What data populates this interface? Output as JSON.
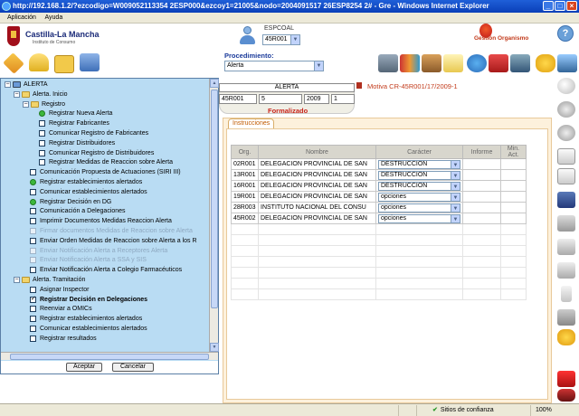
{
  "browser": {
    "title": "http://192.168.1.2/?ezcodigo=W009052113354 2ESP000&ezcoy1=21005&nodo=2004091517 26ESP8254 2# - Gre - Windows Internet Explorer",
    "menu": [
      "Aplicación",
      "Ayuda"
    ]
  },
  "header": {
    "logo_title": "Castilla-La Mancha",
    "logo_subtitle": "Instituto de Consumo",
    "espcoal_label": "ESPCOAL",
    "espcoal_value": "45R001",
    "gestion_label": "Gestión Organismo",
    "help_icon": "?"
  },
  "toolbar": {
    "procedimiento_label": "Procedimiento:",
    "procedimiento_value": "Alerta"
  },
  "record": {
    "title": "ALERTA",
    "fields": [
      "45R001",
      "5",
      "2009",
      "1"
    ],
    "status": "Formalizado",
    "motiva": "Motiva CR-45R001/17/2009-1"
  },
  "instructions": {
    "tab_label": "Instrucciones",
    "columns": [
      "Org.",
      "Nombre",
      "Carácter",
      "Informe",
      "Min. Act."
    ],
    "rows": [
      {
        "org": "02R001",
        "nombre": "DELEGACION PROVINCIAL DE SAN",
        "caracter": "DESTRUCCION"
      },
      {
        "org": "13R001",
        "nombre": "DELEGACION PROVINCIAL DE SAN",
        "caracter": "DESTRUCCION"
      },
      {
        "org": "16R001",
        "nombre": "DELEGACION PROVINCIAL DE SAN",
        "caracter": "DESTRUCCION"
      },
      {
        "org": "19R001",
        "nombre": "DELEGACION PROVINCIAL DE SAN",
        "caracter": "opciones"
      },
      {
        "org": "28R003",
        "nombre": "INSTITUTO NACIONAL DEL CONSU",
        "caracter": "opciones"
      },
      {
        "org": "45R002",
        "nombre": "DELEGACION PROVINCIAL DE SAN",
        "caracter": "opciones"
      }
    ]
  },
  "tree": {
    "items": [
      {
        "label": "ALERTA",
        "level": 0,
        "kind": "root"
      },
      {
        "label": "Alerta. Inicio",
        "level": 1,
        "kind": "folder"
      },
      {
        "label": "Registro",
        "level": 2,
        "kind": "folder"
      },
      {
        "label": "Registrar Nueva Alerta",
        "level": 3,
        "kind": "green"
      },
      {
        "label": "Registrar Fabricantes",
        "level": 3,
        "kind": "check"
      },
      {
        "label": "Comunicar Registro de Fabricantes",
        "level": 3,
        "kind": "check"
      },
      {
        "label": "Registrar Distribuidores",
        "level": 3,
        "kind": "check"
      },
      {
        "label": "Comunicar Registro de Distribuidores",
        "level": 3,
        "kind": "check"
      },
      {
        "label": "Registrar Medidas de Reaccion sobre Alerta",
        "level": 3,
        "kind": "check"
      },
      {
        "label": "Comunicación Propuesta de Actuaciones (SIRI III)",
        "level": 2,
        "kind": "check"
      },
      {
        "label": "Registrar establecimientos alertados",
        "level": 2,
        "kind": "green"
      },
      {
        "label": "Comunicar establecimientos alertados",
        "level": 2,
        "kind": "check"
      },
      {
        "label": "Registrar Decisión en DG",
        "level": 2,
        "kind": "green"
      },
      {
        "label": "Comunicación a Delegaciones",
        "level": 2,
        "kind": "check"
      },
      {
        "label": "Imprimir Documentos Medidas Reaccion Alerta",
        "level": 2,
        "kind": "check"
      },
      {
        "label": "Firmar documentos Medidas de Reaccion sobre Alerta",
        "level": 2,
        "kind": "dim"
      },
      {
        "label": "Enviar Orden Medidas de Reaccion sobre Alerta a los R",
        "level": 2,
        "kind": "check"
      },
      {
        "label": "Enviar Notificación Alerta a Receptores Alerta",
        "level": 2,
        "kind": "dim"
      },
      {
        "label": "Enviar Notificación Alerta a SSA y SIS",
        "level": 2,
        "kind": "dim"
      },
      {
        "label": "Enviar Notificación Alerta a Colegio Farmacéuticos",
        "level": 2,
        "kind": "check"
      },
      {
        "label": "Alerta. Tramitación",
        "level": 1,
        "kind": "folder"
      },
      {
        "label": "Asignar Inspector",
        "level": 2,
        "kind": "check"
      },
      {
        "label": "Registrar Decisión en Delegaciones",
        "level": 2,
        "kind": "checked"
      },
      {
        "label": "Reenviar a OMICs",
        "level": 2,
        "kind": "check"
      },
      {
        "label": "Registrar establecimientos alertados",
        "level": 2,
        "kind": "check"
      },
      {
        "label": "Comunicar establecimientos alertados",
        "level": 2,
        "kind": "check"
      },
      {
        "label": "Registrar resultados",
        "level": 2,
        "kind": "check"
      }
    ],
    "accept_label": "Aceptar",
    "cancel_label": "Cancelar"
  },
  "status_bar": {
    "trusted_sites": "Sitios de confianza",
    "zoom": "100%"
  },
  "colors": {
    "tree_bg": "#b9dcf3",
    "panel_bg": "#fdf1dc",
    "accent_red": "#c8231a",
    "titlebar_blue": "#0a3fb8"
  }
}
